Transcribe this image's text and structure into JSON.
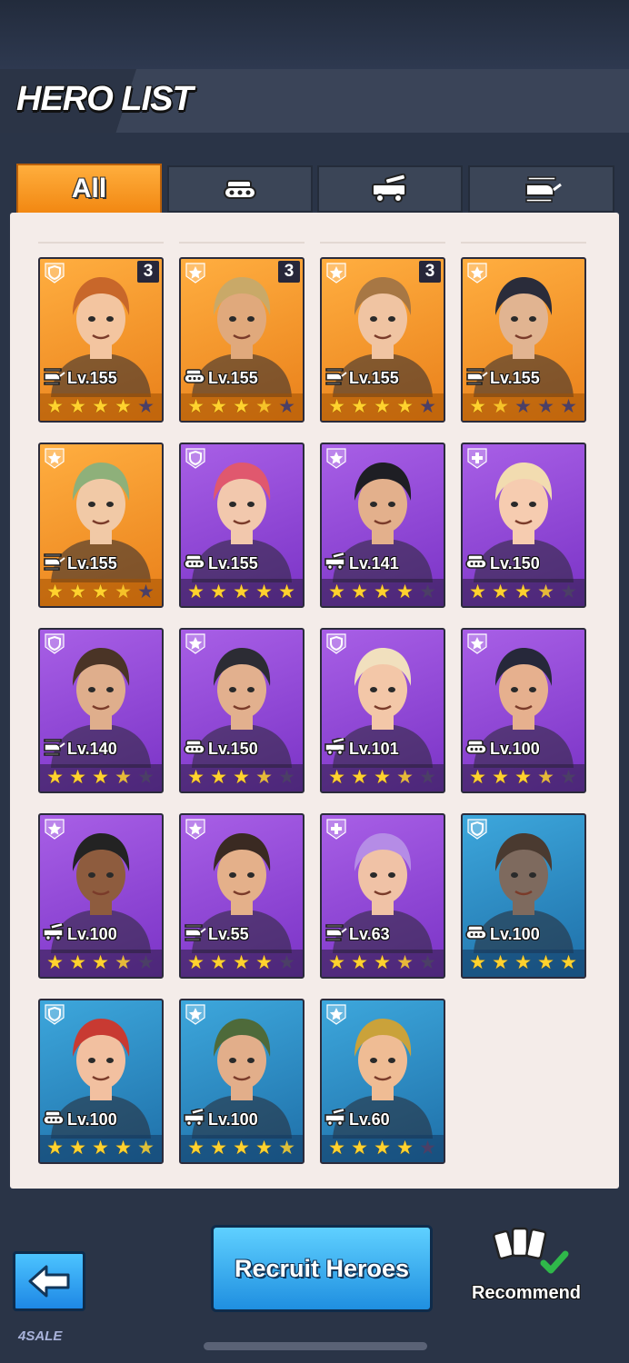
{
  "header": {
    "title": "HERO LIST"
  },
  "tabs": [
    {
      "label": "All",
      "icon": "all",
      "active": true
    },
    {
      "label": "",
      "icon": "tank-icon",
      "active": false
    },
    {
      "label": "",
      "icon": "missile-truck-icon",
      "active": false
    },
    {
      "label": "",
      "icon": "helicopter-icon",
      "active": false
    }
  ],
  "heroes": [
    {
      "level": "Lv.155",
      "count": "3",
      "rarity": "orange",
      "unit": "helicopter",
      "stars": 4.0,
      "class": "shield",
      "hair": "#c8672a",
      "skin": "#f3c5a0"
    },
    {
      "level": "Lv.155",
      "count": "3",
      "rarity": "orange",
      "unit": "tank",
      "stars": 3.5,
      "class": "star",
      "hair": "#c9a968",
      "skin": "#e0a97c"
    },
    {
      "level": "Lv.155",
      "count": "3",
      "rarity": "orange",
      "unit": "helicopter",
      "stars": 4.0,
      "class": "star",
      "hair": "#a77744",
      "skin": "#f0c4a2"
    },
    {
      "level": "Lv.155",
      "count": "",
      "rarity": "orange",
      "unit": "helicopter",
      "stars": 1.5,
      "class": "star",
      "hair": "#2a2c3a",
      "skin": "#e1b491"
    },
    {
      "level": "Lv.155",
      "count": "",
      "rarity": "orange",
      "unit": "helicopter",
      "stars": 3.5,
      "class": "star",
      "hair": "#8eb07a",
      "skin": "#f1c9a6"
    },
    {
      "level": "Lv.155",
      "count": "",
      "rarity": "purple",
      "unit": "tank",
      "stars": 5.0,
      "class": "shield",
      "hair": "#e0586e",
      "skin": "#f2c8ad"
    },
    {
      "level": "Lv.141",
      "count": "",
      "rarity": "purple",
      "unit": "missile",
      "stars": 4.0,
      "class": "star",
      "hair": "#1e1e24",
      "skin": "#e3b08c"
    },
    {
      "level": "Lv.150",
      "count": "",
      "rarity": "purple",
      "unit": "tank",
      "stars": 3.5,
      "class": "cross",
      "hair": "#f2dcb0",
      "skin": "#f6ccb0"
    },
    {
      "level": "Lv.140",
      "count": "",
      "rarity": "purple",
      "unit": "helicopter",
      "stars": 3.5,
      "class": "shield",
      "hair": "#4a3426",
      "skin": "#dfae8c"
    },
    {
      "level": "Lv.150",
      "count": "",
      "rarity": "purple",
      "unit": "tank",
      "stars": 3.5,
      "class": "star",
      "hair": "#2c2c34",
      "skin": "#e2b08e"
    },
    {
      "level": "Lv.101",
      "count": "",
      "rarity": "purple",
      "unit": "missile",
      "stars": 3.5,
      "class": "shield",
      "hair": "#f1e0be",
      "skin": "#f3c7a8"
    },
    {
      "level": "Lv.100",
      "count": "",
      "rarity": "purple",
      "unit": "tank",
      "stars": 3.5,
      "class": "star",
      "hair": "#26283a",
      "skin": "#e6b08e"
    },
    {
      "level": "Lv.100",
      "count": "",
      "rarity": "purple",
      "unit": "missile",
      "stars": 3.5,
      "class": "star",
      "hair": "#232323",
      "skin": "#8e5c3e"
    },
    {
      "level": "Lv.55",
      "count": "",
      "rarity": "purple",
      "unit": "helicopter",
      "stars": 4.0,
      "class": "star",
      "hair": "#3a2a22",
      "skin": "#e4b08a"
    },
    {
      "level": "Lv.63",
      "count": "",
      "rarity": "purple",
      "unit": "helicopter",
      "stars": 3.5,
      "class": "cross",
      "hair": "#b58ce6",
      "skin": "#f0c2a6"
    },
    {
      "level": "Lv.100",
      "count": "",
      "rarity": "blue",
      "unit": "tank",
      "stars": 5.0,
      "class": "shield",
      "hair": "#4a3a30",
      "skin": "#7e6a5e"
    },
    {
      "level": "Lv.100",
      "count": "",
      "rarity": "blue",
      "unit": "tank",
      "stars": 4.5,
      "class": "shield",
      "hair": "#c83a32",
      "skin": "#f2c0a0"
    },
    {
      "level": "Lv.100",
      "count": "",
      "rarity": "blue",
      "unit": "missile",
      "stars": 4.5,
      "class": "star",
      "hair": "#4e6a3a",
      "skin": "#e2ae8a"
    },
    {
      "level": "Lv.60",
      "count": "",
      "rarity": "blue",
      "unit": "missile",
      "stars": 4.0,
      "class": "star",
      "hair": "#caa23a",
      "skin": "#efbc94"
    }
  ],
  "footer": {
    "back_icon": "back-arrow-icon",
    "recruit_label": "Recruit Heroes",
    "recommend_label": "Recommend",
    "watermark": "4SALE"
  },
  "colors": {
    "accent": "#f28812",
    "button": "#1f8fe0",
    "panel": "#f4ece9",
    "background": "#2a3447"
  }
}
